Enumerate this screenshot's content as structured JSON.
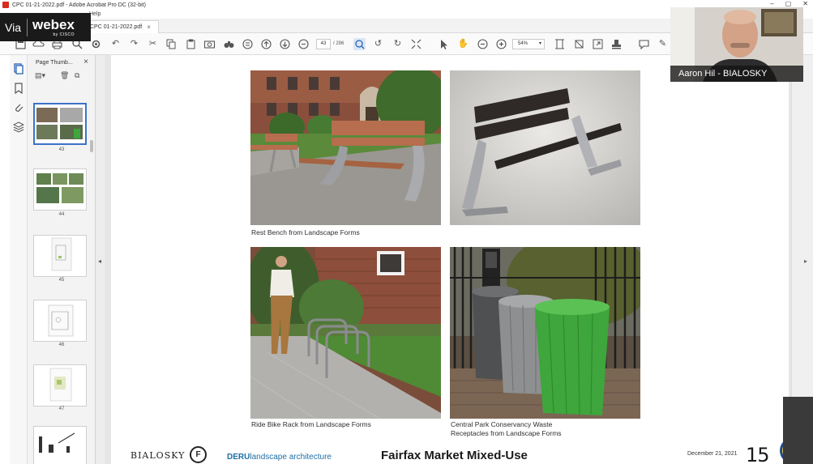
{
  "window": {
    "title": "CPC 01-21-2022.pdf - Adobe Acrobat Pro DC (32-bit)",
    "menu_visible": [
      "Help"
    ]
  },
  "tab": {
    "label": "CPC 01-21-2022.pdf"
  },
  "toolbar": {
    "page_current": "43",
    "page_total": "/ 296",
    "zoom": "54%"
  },
  "thumbnails_panel": {
    "title": "Page Thumb...",
    "pages": [
      "43",
      "44",
      "45",
      "46",
      "47"
    ]
  },
  "webex": {
    "via": "Via",
    "brand": "webex",
    "by": "by CISCO"
  },
  "video": {
    "participant_name": "Aaron Hil - BIALOSKY"
  },
  "document": {
    "captions": [
      "Rest Bench from Landscape Forms",
      "Ride Bike Rack from Landscape Forms",
      "Central Park Conservancy Waste",
      "Receptacles from Landscape Forms"
    ],
    "footer": {
      "firm": "BIALOSKY",
      "logo_letter": "F",
      "partner_bold": "DERU",
      "partner_rest": "landscape architecture",
      "project_title": "Fairfax Market Mixed-Use",
      "date": "December 21, 2021",
      "page_number": "15"
    }
  },
  "colors": {
    "accent_blue": "#3b73c9",
    "bench_wood": "#b66e4e",
    "waste_green": "#3ea63c",
    "deru_blue": "#1e6fa6"
  }
}
